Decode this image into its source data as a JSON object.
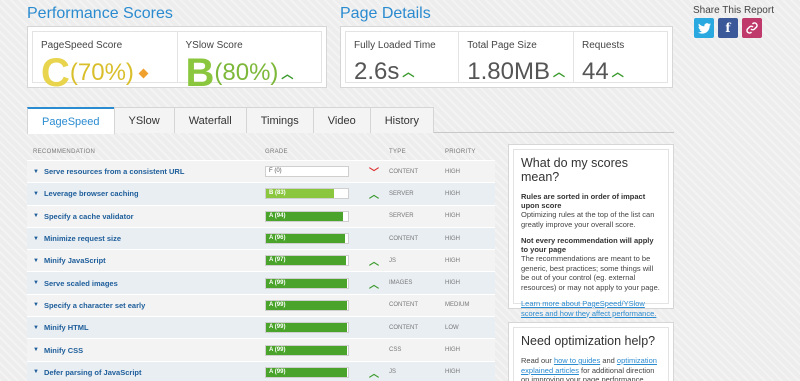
{
  "performance": {
    "title": "Performance Scores",
    "pagespeed": {
      "label": "PageSpeed Score",
      "grade": "C",
      "pct": "(70%)"
    },
    "yslow": {
      "label": "YSlow Score",
      "grade": "B",
      "pct": "(80%)"
    }
  },
  "details": {
    "title": "Page Details",
    "load": {
      "label": "Fully Loaded Time",
      "value": "2.6s"
    },
    "size": {
      "label": "Total Page Size",
      "value": "1.80MB"
    },
    "requests": {
      "label": "Requests",
      "value": "44"
    }
  },
  "share": {
    "title": "Share This Report",
    "icons": [
      "twitter-icon",
      "facebook-icon",
      "link-icon"
    ]
  },
  "tabs": [
    "PageSpeed",
    "YSlow",
    "Waterfall",
    "Timings",
    "Video",
    "History"
  ],
  "table": {
    "headers": {
      "recommendation": "RECOMMENDATION",
      "grade": "GRADE",
      "type": "TYPE",
      "priority": "PRIORITY"
    },
    "rows": [
      {
        "name": "Serve resources from a consistent URL",
        "grade": "F (0)",
        "score": 0,
        "indicator": "down",
        "type": "CONTENT",
        "priority": "HIGH"
      },
      {
        "name": "Leverage browser caching",
        "grade": "B (83)",
        "score": 83,
        "indicator": "up",
        "type": "SERVER",
        "priority": "HIGH"
      },
      {
        "name": "Specify a cache validator",
        "grade": "A (94)",
        "score": 94,
        "indicator": "neutral",
        "type": "SERVER",
        "priority": "HIGH"
      },
      {
        "name": "Minimize request size",
        "grade": "A (96)",
        "score": 96,
        "indicator": "neutral",
        "type": "CONTENT",
        "priority": "HIGH"
      },
      {
        "name": "Minify JavaScript",
        "grade": "A (97)",
        "score": 97,
        "indicator": "up",
        "type": "JS",
        "priority": "HIGH"
      },
      {
        "name": "Serve scaled images",
        "grade": "A (99)",
        "score": 99,
        "indicator": "up",
        "type": "IMAGES",
        "priority": "HIGH"
      },
      {
        "name": "Specify a character set early",
        "grade": "A (99)",
        "score": 99,
        "indicator": "neutral",
        "type": "CONTENT",
        "priority": "MEDIUM"
      },
      {
        "name": "Minify HTML",
        "grade": "A (99)",
        "score": 99,
        "indicator": "neutral",
        "type": "CONTENT",
        "priority": "LOW"
      },
      {
        "name": "Minify CSS",
        "grade": "A (99)",
        "score": 99,
        "indicator": "neutral",
        "type": "CSS",
        "priority": "HIGH"
      },
      {
        "name": "Defer parsing of JavaScript",
        "grade": "A (99)",
        "score": 99,
        "indicator": "up",
        "type": "JS",
        "priority": "HIGH"
      }
    ]
  },
  "scores_info": {
    "title": "What do my scores mean?",
    "b1": "Rules are sorted in order of impact upon score",
    "p1": "Optimizing rules at the top of the list can greatly improve your overall score.",
    "b2": "Not every recommendation will apply to your page",
    "p2": "The recommendations are meant to be generic, best practices; some things will be out of your control (eg. external resources) or may not apply to your page.",
    "link": "Learn more about PageSpeed/YSlow scores and how they affect performance."
  },
  "help": {
    "title": "Need optimization help?",
    "pre": "Read our ",
    "link1": "how to guides",
    "mid": " and ",
    "link2": "optimization explained articles",
    "post": " for additional direction on improving your page performance."
  },
  "colors": {
    "accent": "#2b8bd0",
    "gradeC": "#e8d44d",
    "gradeB": "#8bc63f",
    "bar": "#4aa42b"
  }
}
